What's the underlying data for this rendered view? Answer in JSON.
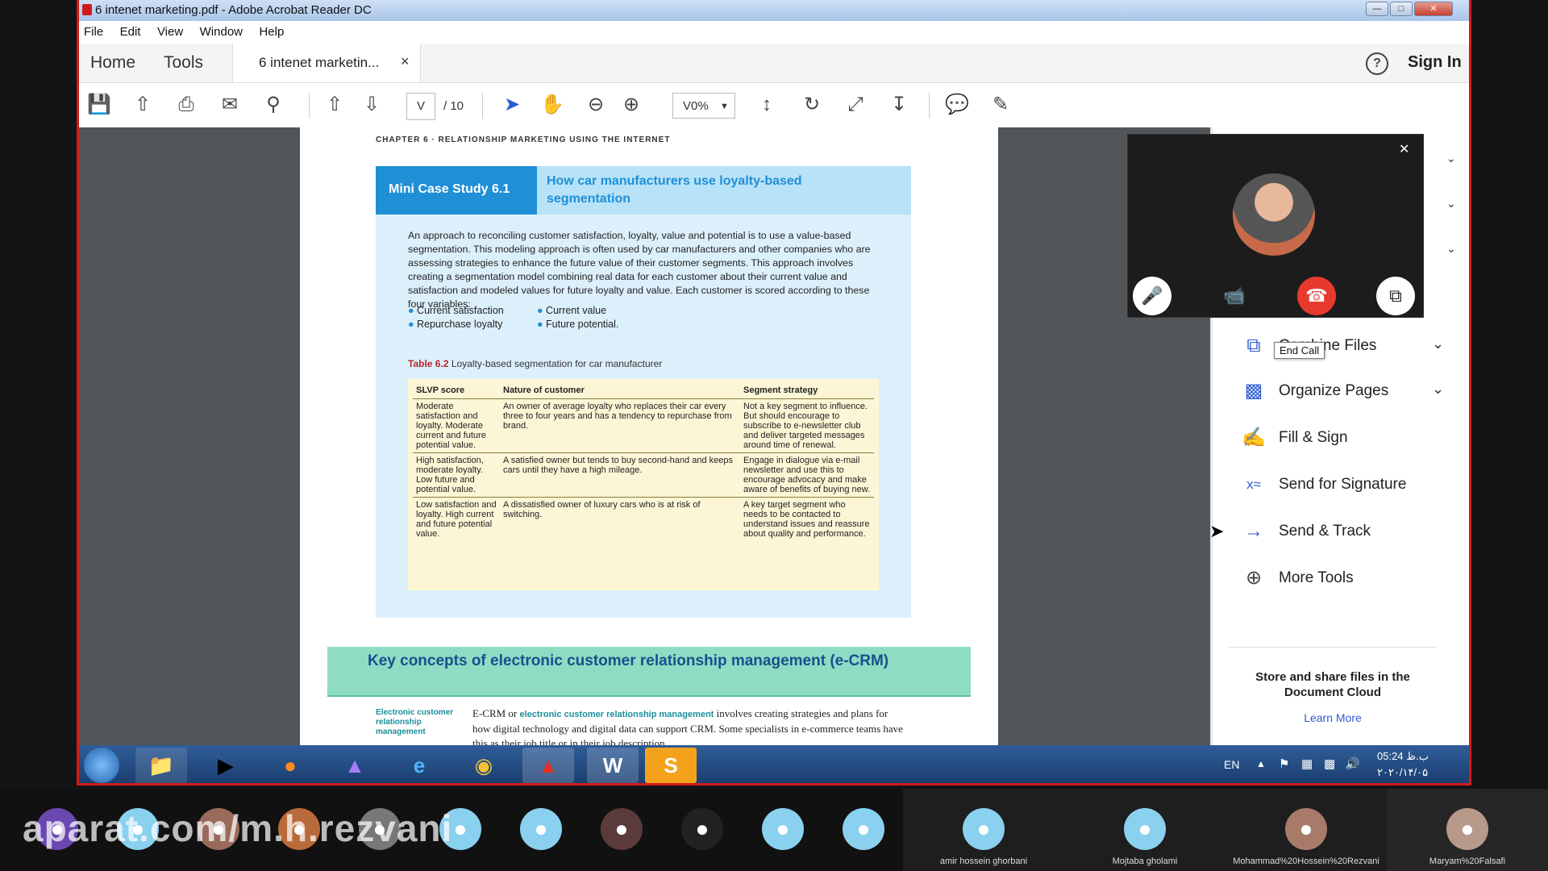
{
  "window": {
    "title": "6 intenet marketing.pdf - Adobe Acrobat Reader DC",
    "menu": [
      "File",
      "Edit",
      "View",
      "Window",
      "Help"
    ],
    "nav_tabs": [
      "Home",
      "Tools"
    ],
    "doc_tab": "6 intenet marketin...",
    "sign_in": "Sign In"
  },
  "toolbar": {
    "page_current": "V",
    "page_total": "/ 10",
    "zoom": "V0%"
  },
  "page": {
    "header": "CHAPTER 6 · RELATIONSHIP MARKETING USING THE INTERNET",
    "case_label": "Mini Case Study 6.1",
    "case_title": "How car manufacturers use loyalty-based segmentation",
    "case_body": "An approach to reconciling customer satisfaction, loyalty, value and potential is to use a value-based segmentation. This modeling approach is often used by car manufacturers and other companies who are assessing strategies to enhance the future value of their customer segments. This approach involves creating a segmentation model combining real data for each customer about their current value and satisfaction and modeled values for future loyalty and value. Each customer is scored according to these four variables:",
    "bullets": [
      "Current satisfaction",
      "Repurchase loyalty",
      "Current value",
      "Future potential."
    ],
    "table_label": "Table 6.2",
    "table_caption": "Loyalty-based segmentation for car manufacturer",
    "table_headers": [
      "SLVP score",
      "Nature of customer",
      "Segment strategy"
    ],
    "table_rows": [
      [
        "Moderate satisfaction and loyalty. Moderate current and future potential value.",
        "An owner of average loyalty who replaces their car every three to four years and has a tendency to repurchase from brand.",
        "Not a key segment to influence. But should encourage to subscribe to e-newsletter club and deliver targeted messages around time of renewal."
      ],
      [
        "High satisfaction, moderate loyalty. Low future and potential value.",
        "A satisfied owner but tends to buy second-hand and keeps cars until they have a high mileage.",
        "Engage in dialogue via e-mail newsletter and use this to encourage advocacy and make aware of benefits of buying new."
      ],
      [
        "Low satisfaction and loyalty. High current and future potential value.",
        "A dissatisfied owner of luxury cars who is at risk of switching.",
        "A key target segment who needs to be contacted to understand issues and reassure about quality and performance."
      ]
    ],
    "section_title": "Key concepts of electronic customer relationship management (e-CRM)",
    "margin_term": "Electronic customer relationship management",
    "body_lead": "E-CRM or",
    "body_term": "electronic customer relationship management",
    "body_rest": "involves creating strategies and plans for how digital technology and digital data can support CRM. Some specialists in e-commerce teams have this as their job title or in their job description."
  },
  "tools_panel": {
    "items": [
      {
        "label": "Combine Files",
        "icon": "combine-files-icon"
      },
      {
        "label": "Organize Pages",
        "icon": "organize-pages-icon"
      },
      {
        "label": "Fill & Sign",
        "icon": "fill-sign-icon"
      },
      {
        "label": "Send for Signature",
        "icon": "send-signature-icon"
      },
      {
        "label": "Send & Track",
        "icon": "send-track-icon"
      },
      {
        "label": "More Tools",
        "icon": "more-tools-icon"
      }
    ],
    "cloud_text": "Store and share files in the Document Cloud",
    "learn_more": "Learn More"
  },
  "call": {
    "tooltip": "End Call"
  },
  "taskbar": {
    "lang": "EN",
    "time": "05:24 ب.ظ",
    "date": "۲۰۲۰/۱۴/۰۵"
  },
  "participants": [
    {
      "name": ""
    },
    {
      "name": ""
    },
    {
      "name": ""
    },
    {
      "name": ""
    },
    {
      "name": ""
    },
    {
      "name": ""
    },
    {
      "name": ""
    },
    {
      "name": ""
    },
    {
      "name": ""
    },
    {
      "name": ""
    },
    {
      "name": ""
    },
    {
      "name": "amir hossein ghorbani"
    },
    {
      "name": "Mojtaba gholami"
    },
    {
      "name": "Mohammad%20Hossein%20Rezvani"
    },
    {
      "name": "Maryam%20Falsafi"
    }
  ],
  "watermark": "aparat.com/m.h.rezvani",
  "colors": {
    "acrobat_red": "#d11a1a",
    "case_blue": "#1f8fd6",
    "case_bg": "#dcf0fb",
    "table_bg": "#fdf6d6",
    "section_green": "#8fdcc4",
    "tool_blue": "#2d5bd1",
    "end_call": "#e8392f"
  }
}
